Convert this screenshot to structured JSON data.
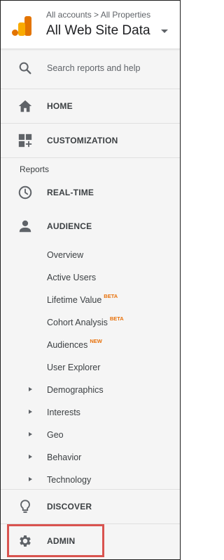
{
  "header": {
    "breadcrumb": "All accounts > All Properties",
    "view_title": "All Web Site Data"
  },
  "search": {
    "label": "Search reports and help"
  },
  "nav": {
    "home": "HOME",
    "customization": "CUSTOMIZATION",
    "reports_label": "Reports",
    "realtime": "REAL-TIME",
    "audience": "AUDIENCE",
    "discover": "DISCOVER",
    "admin": "ADMIN"
  },
  "audience_items": [
    {
      "label": "Overview",
      "badge": ""
    },
    {
      "label": "Active Users",
      "badge": ""
    },
    {
      "label": "Lifetime Value",
      "badge": "BETA"
    },
    {
      "label": "Cohort Analysis",
      "badge": "BETA"
    },
    {
      "label": "Audiences",
      "badge": "NEW"
    },
    {
      "label": "User Explorer",
      "badge": ""
    },
    {
      "label": "Demographics",
      "badge": ""
    },
    {
      "label": "Interests",
      "badge": ""
    },
    {
      "label": "Geo",
      "badge": ""
    },
    {
      "label": "Behavior",
      "badge": ""
    },
    {
      "label": "Technology",
      "badge": ""
    }
  ],
  "colors": {
    "highlight": "#d9534f",
    "badge": "#e8710a",
    "logo_dark": "#e37400",
    "logo_light": "#f9ab00"
  },
  "icons": {
    "logo": "analytics-logo-icon",
    "search": "search-icon",
    "home": "home-icon",
    "customization": "dashboard-plus-icon",
    "realtime": "clock-icon",
    "audience": "person-icon",
    "expand": "triangle-right-icon",
    "discover": "lightbulb-icon",
    "admin": "gear-icon",
    "view_switch": "caret-down-icon"
  }
}
